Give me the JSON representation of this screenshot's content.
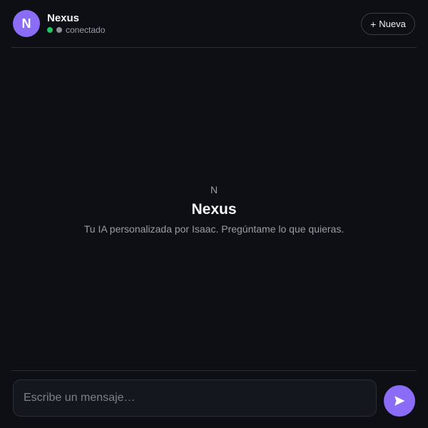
{
  "header": {
    "avatar_initial": "N",
    "title": "Nexus",
    "status_text": "conectado",
    "new_button_label": "Nueva",
    "new_button_icon": "plus-icon"
  },
  "empty_state": {
    "letter": "N",
    "title": "Nexus",
    "subtitle": "Tu IA personalizada por Isaac. Pregúntame lo que quieras."
  },
  "composer": {
    "placeholder": "Escribe un mensaje…",
    "value": "",
    "send_icon": "send-icon"
  },
  "colors": {
    "background": "#0e0f14",
    "accent": "#8b6cf6",
    "online": "#22c55e"
  }
}
